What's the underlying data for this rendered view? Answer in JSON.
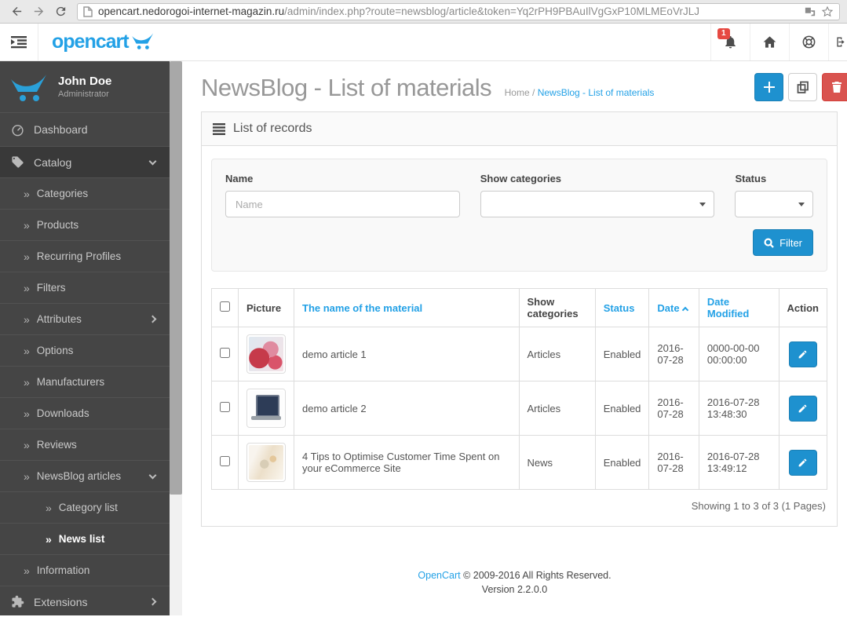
{
  "browser": {
    "url": {
      "domain": "opencart.nedorogoi-internet-magazin.ru",
      "path": "/admin/index.php?route=newsblog/article&token=Yq2rPH9PBAuIlVgGxP10MLMEoVrJLJ"
    }
  },
  "header": {
    "logo_text": "opencart",
    "notification_count": "1"
  },
  "sidebar": {
    "user": {
      "name": "John Doe",
      "role": "Administrator"
    },
    "items": [
      {
        "label": "Dashboard"
      },
      {
        "label": "Catalog"
      },
      {
        "label": "Categories"
      },
      {
        "label": "Products"
      },
      {
        "label": "Recurring Profiles"
      },
      {
        "label": "Filters"
      },
      {
        "label": "Attributes"
      },
      {
        "label": "Options"
      },
      {
        "label": "Manufacturers"
      },
      {
        "label": "Downloads"
      },
      {
        "label": "Reviews"
      },
      {
        "label": "NewsBlog articles"
      },
      {
        "label": "Category list"
      },
      {
        "label": "News list"
      },
      {
        "label": "Information"
      },
      {
        "label": "Extensions"
      }
    ]
  },
  "page": {
    "title": "NewsBlog - List of materials",
    "breadcrumb": {
      "home": "Home",
      "separator": "/",
      "current": "NewsBlog - List of materials"
    }
  },
  "panel": {
    "heading": "List of records"
  },
  "filter": {
    "name_label": "Name",
    "name_placeholder": "Name",
    "name_value": "",
    "categories_label": "Show categories",
    "categories_value": "",
    "status_label": "Status",
    "status_value": "",
    "button_label": "Filter"
  },
  "table": {
    "headers": {
      "picture": "Picture",
      "name": "The name of the material",
      "categories": "Show categories",
      "status": "Status",
      "date": "Date",
      "date_modified": "Date Modified",
      "action": "Action"
    },
    "sort": {
      "column": "Date",
      "direction": "asc"
    },
    "rows": [
      {
        "picture": "flowers-photo",
        "name": "demo article 1",
        "categories": "Articles",
        "status": "Enabled",
        "date": "2016-07-28",
        "date_modified": "0000-00-00 00:00:00"
      },
      {
        "picture": "laptop-photo",
        "name": "demo article 2",
        "categories": "Articles",
        "status": "Enabled",
        "date": "2016-07-28",
        "date_modified": "2016-07-28 13:48:30"
      },
      {
        "picture": "documents-photo",
        "name": "4 Tips to Optimise Customer Time Spent on your eCommerce Site",
        "categories": "News",
        "status": "Enabled",
        "date": "2016-07-28",
        "date_modified": "2016-07-28 13:49:12"
      }
    ],
    "results_text": "Showing 1 to 3 of 3 (1 Pages)"
  },
  "footer": {
    "link_text": "OpenCart",
    "copyright_text": "© 2009-2016 All Rights Reserved.",
    "version_text": "Version 2.2.0.0"
  },
  "colors": {
    "accent_blue": "#1e91cf",
    "link_blue": "#23a1e6",
    "danger_red": "#d9534f",
    "sidebar_dark": "#454545",
    "badge_red": "#e64942"
  }
}
